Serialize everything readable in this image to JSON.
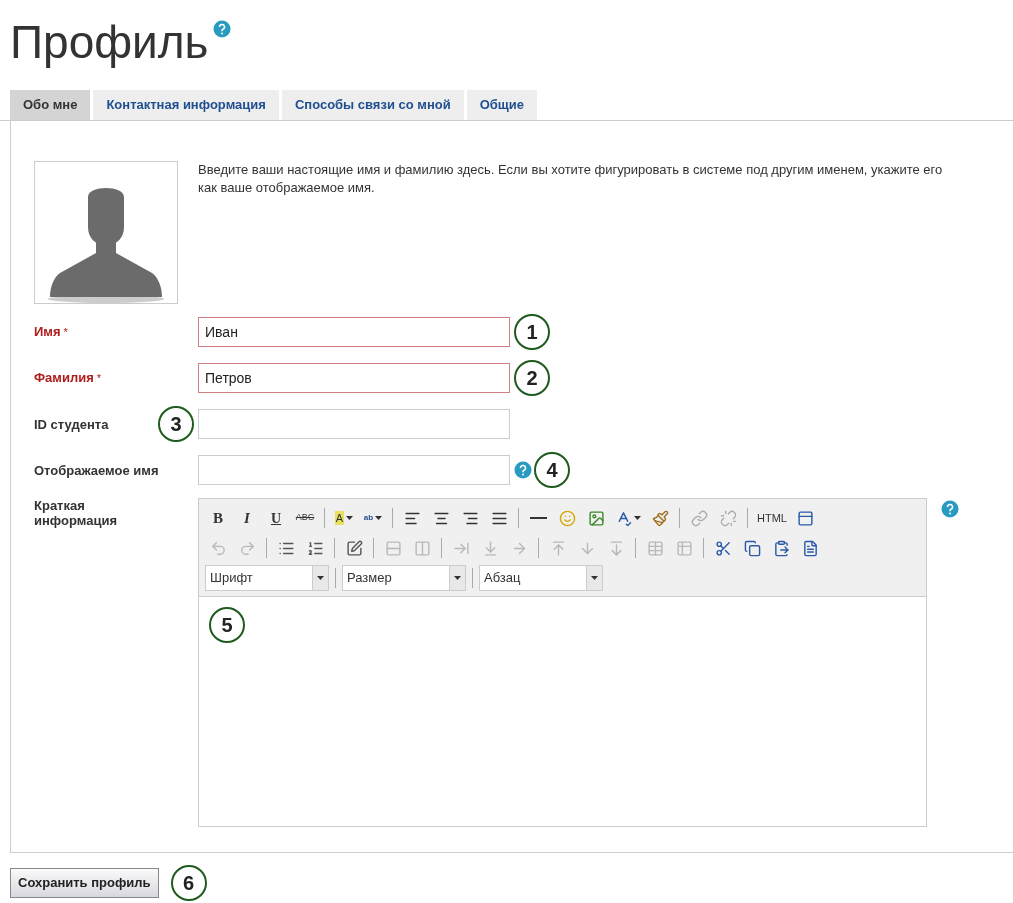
{
  "page": {
    "title": "Профиль",
    "help": true
  },
  "tabs": [
    {
      "label": "Обо мне",
      "selected": true
    },
    {
      "label": "Контактная информация",
      "selected": false
    },
    {
      "label": "Способы связи со мной",
      "selected": false
    },
    {
      "label": "Общие",
      "selected": false
    }
  ],
  "intro": "Введите ваши настоящие имя и фамилию здесь. Если вы хотите фигурировать в системе под другим именем, укажите его как ваше отображаемое имя.",
  "fields": [
    {
      "label": "Имя",
      "required": true,
      "marker": "*",
      "value": "Иван",
      "callout": "1"
    },
    {
      "label": "Фамилия",
      "required": true,
      "marker": "*",
      "value": "Петров",
      "callout": "2"
    },
    {
      "label": "ID студента",
      "required": false,
      "callout": "3"
    },
    {
      "label": "Отображаемое имя",
      "required": false,
      "callout": "4",
      "help": true
    }
  ],
  "editor": {
    "label": "Краткая информация",
    "help": true,
    "callout": "5",
    "toolbar_rows": [
      [
        {
          "kind": "text",
          "label": "B",
          "disabled": false
        },
        {
          "kind": "text",
          "label": "I",
          "disabled": false
        },
        {
          "kind": "text",
          "label": "U",
          "disabled": false
        },
        {
          "kind": "text",
          "label": "ABC",
          "disabled": false
        },
        {
          "kind": "separator"
        },
        {
          "kind": "text",
          "label": "A",
          "disabled": false,
          "dropdown": true
        },
        {
          "kind": "text",
          "label": "ab",
          "disabled": false,
          "dropdown": true
        },
        {
          "kind": "separator"
        },
        {
          "kind": "icon",
          "disabled": false
        },
        {
          "kind": "icon",
          "disabled": false
        },
        {
          "kind": "icon",
          "disabled": false
        },
        {
          "kind": "icon",
          "disabled": false
        },
        {
          "kind": "separator"
        },
        {
          "kind": "icon",
          "disabled": false
        },
        {
          "kind": "icon",
          "disabled": false
        },
        {
          "kind": "icon",
          "disabled": false
        },
        {
          "kind": "icon",
          "disabled": false,
          "dropdown": true
        },
        {
          "kind": "icon",
          "disabled": false
        },
        {
          "kind": "separator"
        },
        {
          "kind": "icon",
          "disabled": true
        },
        {
          "kind": "icon",
          "disabled": true
        },
        {
          "kind": "separator"
        },
        {
          "kind": "text",
          "label": "HTML",
          "disabled": false
        },
        {
          "kind": "icon",
          "disabled": false
        }
      ],
      [
        {
          "kind": "icon",
          "disabled": true
        },
        {
          "kind": "icon",
          "disabled": true
        },
        {
          "kind": "separator"
        },
        {
          "kind": "icon",
          "disabled": false
        },
        {
          "kind": "icon",
          "disabled": false
        },
        {
          "kind": "separator"
        },
        {
          "kind": "icon",
          "disabled": false
        },
        {
          "kind": "separator"
        },
        {
          "kind": "icon",
          "disabled": true
        },
        {
          "kind": "icon",
          "disabled": true
        },
        {
          "kind": "separator"
        },
        {
          "kind": "icon",
          "disabled": true
        },
        {
          "kind": "icon",
          "disabled": true
        },
        {
          "kind": "icon",
          "disabled": true
        },
        {
          "kind": "separator"
        },
        {
          "kind": "icon",
          "disabled": true
        },
        {
          "kind": "icon",
          "disabled": true
        },
        {
          "kind": "icon",
          "disabled": true
        },
        {
          "kind": "separator"
        },
        {
          "kind": "icon",
          "disabled": true
        },
        {
          "kind": "icon",
          "disabled": true
        },
        {
          "kind": "separator"
        },
        {
          "kind": "icon",
          "disabled": false
        },
        {
          "kind": "icon",
          "disabled": false
        },
        {
          "kind": "icon",
          "disabled": false
        },
        {
          "kind": "icon",
          "disabled": false
        }
      ],
      [
        {
          "kind": "select",
          "label": "Шрифт"
        },
        {
          "kind": "separator"
        },
        {
          "kind": "select",
          "label": "Размер"
        },
        {
          "kind": "separator"
        },
        {
          "kind": "select",
          "label": "Абзац"
        }
      ]
    ]
  },
  "save": {
    "label": "Сохранить профиль",
    "callout": "6"
  }
}
